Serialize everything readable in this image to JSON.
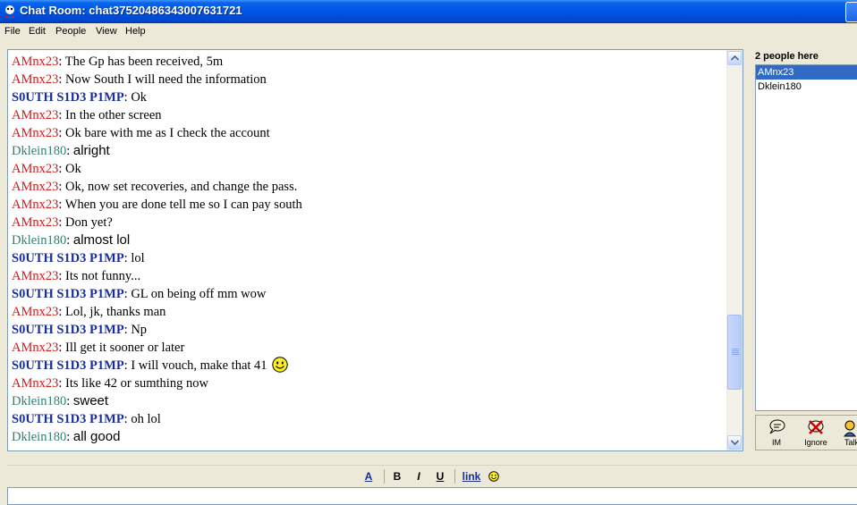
{
  "window": {
    "title": "Chat Room: chat37520486343007631721"
  },
  "menu": [
    "File",
    "Edit",
    "People",
    "View",
    "Help"
  ],
  "messages": [
    {
      "nick": "AMnx23",
      "text": "The Gp has been received, 5m"
    },
    {
      "nick": "AMnx23",
      "text": "Now South I will need the information"
    },
    {
      "nick": "S0UTH S1D3 P1MP",
      "text": "Ok"
    },
    {
      "nick": "AMnx23",
      "text": "In the other screen"
    },
    {
      "nick": "AMnx23",
      "text": "Ok bare with me as I check the account"
    },
    {
      "nick": "Dklein180",
      "text": "alright"
    },
    {
      "nick": "AMnx23",
      "text": "Ok"
    },
    {
      "nick": "AMnx23",
      "text": "Ok, now set recoveries, and change the pass."
    },
    {
      "nick": "AMnx23",
      "text": "When you are done tell me so I can pay south"
    },
    {
      "nick": "AMnx23",
      "text": "Don yet?"
    },
    {
      "nick": "Dklein180",
      "text": "almost lol"
    },
    {
      "nick": "S0UTH S1D3 P1MP",
      "text": "lol"
    },
    {
      "nick": "AMnx23",
      "text": "Its not funny..."
    },
    {
      "nick": "S0UTH S1D3 P1MP",
      "text": "GL on being off mm wow"
    },
    {
      "nick": "AMnx23",
      "text": "Lol, jk, thanks man"
    },
    {
      "nick": "S0UTH S1D3 P1MP",
      "text": "Np"
    },
    {
      "nick": "AMnx23",
      "text": "Ill get it sooner or later"
    },
    {
      "nick": "S0UTH S1D3 P1MP",
      "text": "I will vouch, make that 41"
    },
    {
      "nick": "AMnx23",
      "text": "Its like 42 or sumthing now"
    },
    {
      "nick": "Dklein180",
      "text": "sweet"
    },
    {
      "nick": "S0UTH S1D3 P1MP",
      "text": "oh lol"
    },
    {
      "nick": "Dklein180",
      "text": "all good"
    }
  ],
  "people": {
    "count_label": "2 people here",
    "items": [
      "AMnx23",
      "Dklein180"
    ]
  },
  "actions": {
    "im": "IM",
    "ignore": "Ignore",
    "talk": "Talk"
  },
  "format": {
    "color": "A",
    "bold": "B",
    "italic": "I",
    "underline": "U",
    "link": "link"
  },
  "colors": {
    "amnx": "#cc1c1c",
    "south": "#1a2e99",
    "dklein": "#2f7f6f",
    "selection": "#316ac5"
  }
}
